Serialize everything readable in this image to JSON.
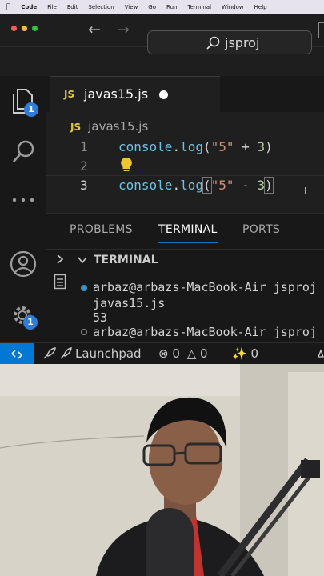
{
  "menubar": {
    "app": "Code",
    "items": [
      "File",
      "Edit",
      "Selection",
      "View",
      "Go",
      "Run",
      "Terminal",
      "Window",
      "Help"
    ]
  },
  "titlebar": {
    "search_text": "jsproj"
  },
  "activity": {
    "explorer_badge": "1",
    "settings_badge": "1"
  },
  "tabs": [
    {
      "icon": "JS",
      "label": "javas15.js",
      "modified": true
    }
  ],
  "breadcrumb": {
    "icon": "JS",
    "label": "javas15.js"
  },
  "editor": {
    "lines": [
      {
        "number": "1",
        "func": "console",
        "dot": ".",
        "method": "log",
        "open": "(",
        "str": "\"5\"",
        "op": " + ",
        "num": "3",
        "close": ")"
      },
      {
        "number": "2"
      },
      {
        "number": "3",
        "func": "console",
        "dot": ".",
        "method": "log",
        "open": "(",
        "str": "\"5\"",
        "op": " - ",
        "num": "3",
        "close": ")"
      }
    ]
  },
  "panel": {
    "tabs": [
      "PROBLEMS",
      "TERMINAL",
      "PORTS"
    ],
    "active_tab": "TERMINAL",
    "section_title": "TERMINAL",
    "terminal_lines": [
      "arbaz@arbazs-MacBook-Air jsproj",
      "javas15.js",
      "53",
      "arbaz@arbazs-MacBook-Air jsproj"
    ]
  },
  "status": {
    "launchpad": "Launchpad",
    "errors": "0",
    "warnings": "0",
    "ports": "0"
  },
  "colors": {
    "accent": "#0078d4",
    "badge": "#2f7bd8",
    "js_icon": "#e2c542"
  }
}
